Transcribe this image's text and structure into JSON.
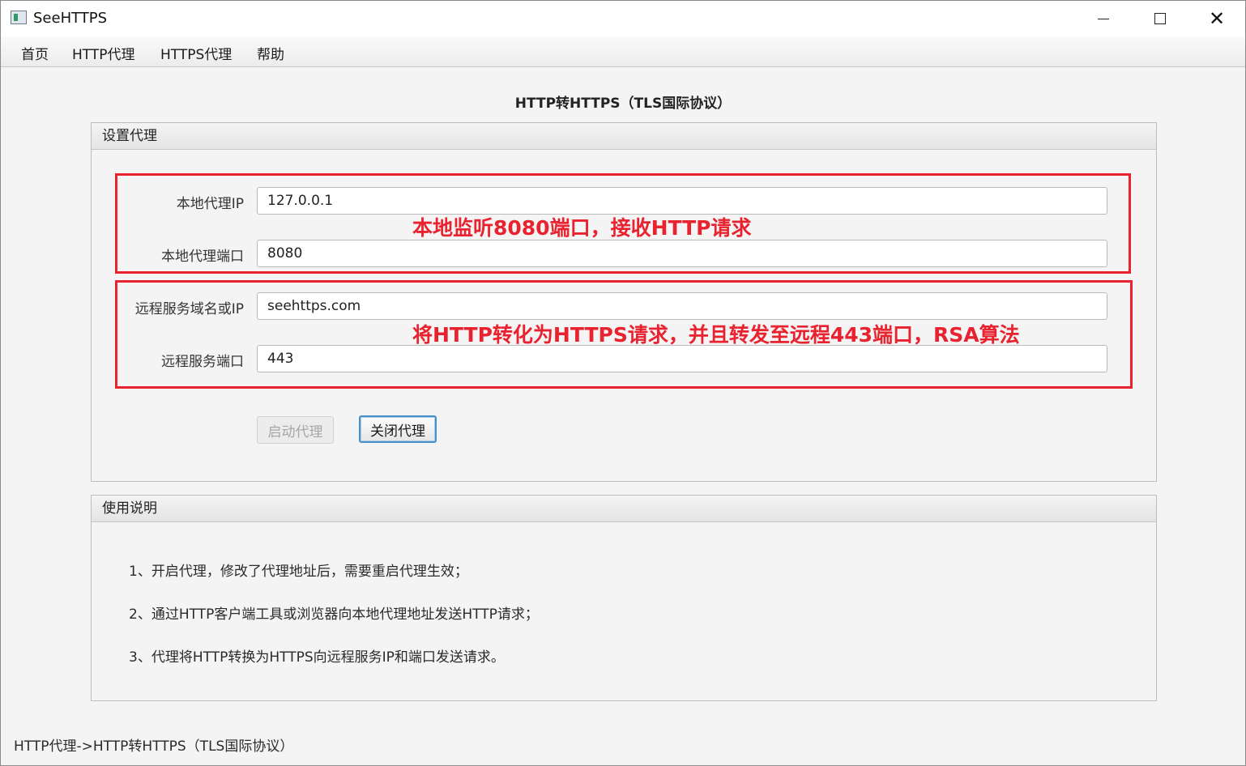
{
  "window": {
    "title": "SeeHTTPS",
    "controls": {
      "minimize": "minimize-icon",
      "maximize": "maximize-icon",
      "close": "✕"
    }
  },
  "menu": [
    "首页",
    "HTTP代理",
    "HTTPS代理",
    "帮助"
  ],
  "page": {
    "heading": "HTTP转HTTPS（TLS国际协议）"
  },
  "proxy_panel": {
    "title": "设置代理",
    "fields": [
      {
        "label": "本地代理IP",
        "value": "127.0.0.1"
      },
      {
        "label": "本地代理端口",
        "value": "8080"
      },
      {
        "label": "远程服务域名或IP",
        "value": "seehttps.com"
      },
      {
        "label": "远程服务端口",
        "value": "443"
      }
    ],
    "annotations": [
      "本地监听8080端口，接收HTTP请求",
      "将HTTP转化为HTTPS请求，并且转发至远程443端口，RSA算法"
    ],
    "start_button": "启动代理",
    "stop_button": "关闭代理"
  },
  "help_panel": {
    "title": "使用说明",
    "items": [
      "1、开启代理，修改了代理地址后，需要重启代理生效；",
      "2、通过HTTP客户端工具或浏览器向本地代理地址发送HTTP请求；",
      "3、代理将HTTP转换为HTTPS向远程服务IP和端口发送请求。"
    ]
  },
  "status_bar": "HTTP代理->HTTP转HTTPS（TLS国际协议）",
  "colors": {
    "annotation_red": "#e8232f",
    "focus_blue": "#4a90c8"
  }
}
